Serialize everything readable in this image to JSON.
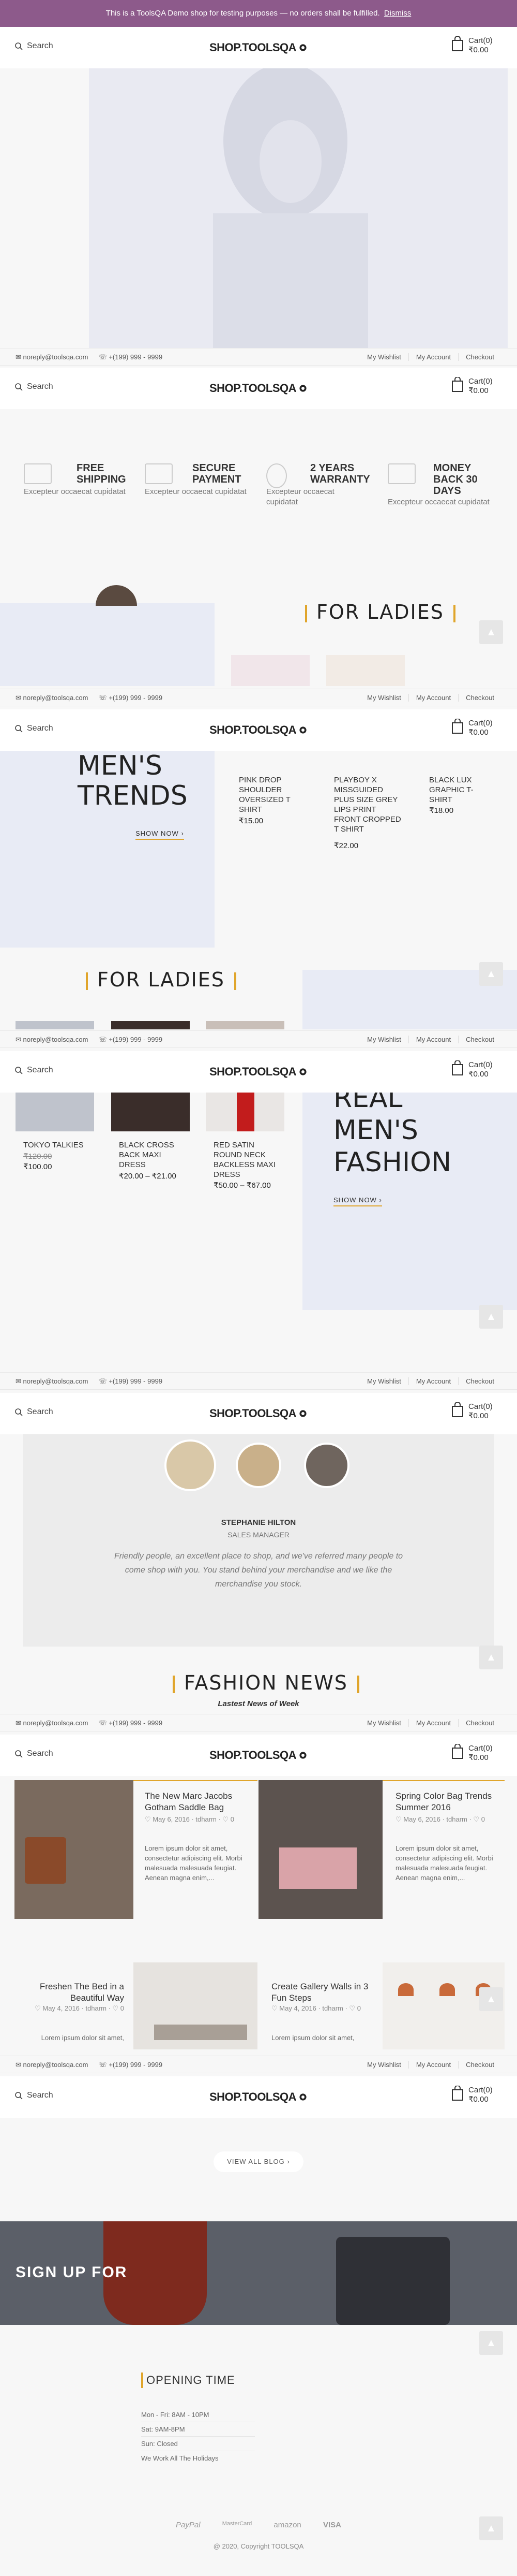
{
  "demo_bar": {
    "text": "This is a ToolsQA Demo shop for testing purposes — no orders shall be fulfilled.",
    "dismiss": "Dismiss"
  },
  "header": {
    "search_label": "Search",
    "logo_text": "SHOP.TOOLSQA",
    "cart_label": "Cart(0)",
    "cart_total": "₹0.00"
  },
  "topbar": {
    "email": "noreply@toolsqa.com",
    "phone": "+(199) 999 - 9999",
    "links": [
      "My Wishlist",
      "My Account",
      "Checkout"
    ]
  },
  "features": [
    {
      "title": "FREE SHIPPING",
      "desc": "Excepteur occaecat cupidatat"
    },
    {
      "title": "SECURE PAYMENT",
      "desc": "Excepteur occaecat cupidatat"
    },
    {
      "title": "2 YEARS WARRANTY",
      "desc": "Excepteur occaecat cupidatat"
    },
    {
      "title": "MONEY BACK 30 DAYS",
      "desc": "Excepteur occaecat cupidatat"
    }
  ],
  "sections": {
    "for_ladies": "FOR LADIES",
    "mens_trends": "MEN'S TRENDS",
    "real_mens_fashion": "REAL MEN'S FASHION",
    "fashion_news": "FASHION NEWS",
    "latest_news": "Lastest News of Week",
    "show_now": "SHOW NOW"
  },
  "men_products": [
    {
      "name": "PINK DROP SHOULDER OVERSIZED T SHIRT",
      "price": "₹15.00"
    },
    {
      "name": "PLAYBOY X MISSGUIDED PLUS SIZE GREY LIPS PRINT FRONT CROPPED T SHIRT",
      "price": "₹22.00"
    },
    {
      "name": "BLACK LUX GRAPHIC T-SHIRT",
      "price": "₹18.00"
    }
  ],
  "ladies_products": [
    {
      "name": "TOKYO TALKIES",
      "old_price": "₹120.00",
      "price": "₹100.00"
    },
    {
      "name": "BLACK CROSS BACK MAXI DRESS",
      "price": "₹20.00 – ₹21.00"
    },
    {
      "name": "RED SATIN ROUND NECK BACKLESS MAXI DRESS",
      "price": "₹50.00 – ₹67.00"
    }
  ],
  "testimonial": {
    "name": "STEPHANIE HILTON",
    "role": "SALES MANAGER",
    "quote": "Friendly people, an excellent place to shop, and we've referred many people to come shop with you. You stand behind your merchandise and we like the merchandise you stock."
  },
  "news": [
    {
      "title": "The New Marc Jacobs Gotham Saddle Bag",
      "date": "May 6, 2016",
      "author": "tdharm",
      "comments": "0",
      "body": "Lorem ipsum dolor sit amet, consectetur adipiscing elit. Morbi malesuada malesuada feugiat. Aenean magna enim,..."
    },
    {
      "title": "Spring Color Bag Trends Summer 2016",
      "date": "May 6, 2016",
      "author": "tdharm",
      "comments": "0",
      "body": "Lorem ipsum dolor sit amet, consectetur adipiscing elit. Morbi malesuada malesuada feugiat. Aenean magna enim,..."
    },
    {
      "title": "Freshen The Bed in a Beautiful Way",
      "date": "May 4, 2016",
      "author": "tdharm",
      "comments": "0",
      "body": "Lorem ipsum dolor sit amet,"
    },
    {
      "title": "Create Gallery Walls in 3 Fun Steps",
      "date": "May 4, 2016",
      "author": "tdharm",
      "comments": "0",
      "body": "Lorem ipsum dolor sit amet,"
    }
  ],
  "view_all_blog": "VIEW ALL BLOG",
  "signup": "SIGN UP FOR",
  "opening": {
    "title": "OPENING TIME",
    "rows": [
      "Mon - Fri: 8AM - 10PM",
      "Sat: 9AM-8PM",
      "Sun: Closed",
      "We Work All The Holidays"
    ]
  },
  "payments": [
    "PayPal",
    "MasterCard",
    "amazon",
    "VISA"
  ],
  "copyright": "@ 2020, Copyright TOOLSQA",
  "colors": {
    "accent": "#e0a52b",
    "demo_bar": "#8d5a8b",
    "panel": "#e8ebf5"
  }
}
